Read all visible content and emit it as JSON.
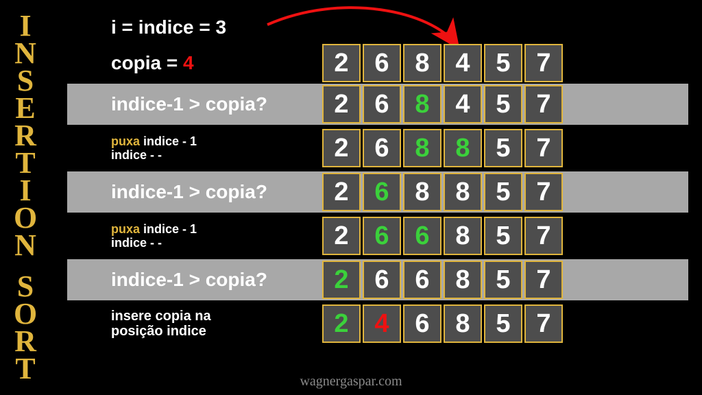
{
  "title": "INSERTION SORT",
  "top": {
    "line1": "i = indice = 3",
    "copia_label": "copia = ",
    "copia_val": "4"
  },
  "steps": [
    {
      "bg": "gray",
      "text_mode": "big",
      "text": "indice-1 > copia?"
    },
    {
      "bg": "black",
      "text_mode": "puxa",
      "t1_pre": "puxa",
      "t1_post": " indice - 1",
      "t2": "indice - -"
    },
    {
      "bg": "gray",
      "text_mode": "big",
      "text": "indice-1 > copia?"
    },
    {
      "bg": "black",
      "text_mode": "puxa",
      "t1_pre": "puxa",
      "t1_post": " indice - 1",
      "t2": "indice - -"
    },
    {
      "bg": "gray",
      "text_mode": "big",
      "text": "indice-1 > copia?"
    },
    {
      "bg": "black",
      "text_mode": "ins",
      "t1": "insere copia na",
      "t2": "posição indice"
    }
  ],
  "arrays": [
    [
      {
        "v": "2"
      },
      {
        "v": "6"
      },
      {
        "v": "8"
      },
      {
        "v": "4"
      },
      {
        "v": "5"
      },
      {
        "v": "7"
      }
    ],
    [
      {
        "v": "2"
      },
      {
        "v": "6"
      },
      {
        "v": "8",
        "c": "green"
      },
      {
        "v": "4"
      },
      {
        "v": "5"
      },
      {
        "v": "7"
      }
    ],
    [
      {
        "v": "2"
      },
      {
        "v": "6"
      },
      {
        "v": "8",
        "c": "green"
      },
      {
        "v": "8",
        "c": "green"
      },
      {
        "v": "5"
      },
      {
        "v": "7"
      }
    ],
    [
      {
        "v": "2"
      },
      {
        "v": "6",
        "c": "green"
      },
      {
        "v": "8"
      },
      {
        "v": "8"
      },
      {
        "v": "5"
      },
      {
        "v": "7"
      }
    ],
    [
      {
        "v": "2"
      },
      {
        "v": "6",
        "c": "green"
      },
      {
        "v": "6",
        "c": "green"
      },
      {
        "v": "8"
      },
      {
        "v": "5"
      },
      {
        "v": "7"
      }
    ],
    [
      {
        "v": "2",
        "c": "green"
      },
      {
        "v": "6"
      },
      {
        "v": "6"
      },
      {
        "v": "8"
      },
      {
        "v": "5"
      },
      {
        "v": "7"
      }
    ],
    [
      {
        "v": "2",
        "c": "green"
      },
      {
        "v": "4",
        "c": "red"
      },
      {
        "v": "6"
      },
      {
        "v": "8"
      },
      {
        "v": "5"
      },
      {
        "v": "7"
      }
    ]
  ],
  "footer": "wagnergaspar.com"
}
